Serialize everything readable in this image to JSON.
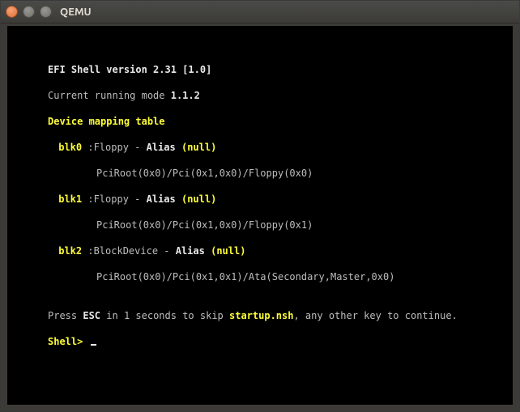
{
  "window": {
    "title": "QEMU"
  },
  "efi": {
    "shell_label": "EFI Shell version ",
    "shell_version": "2.31 [1.0]",
    "mode_label": "Current running mode ",
    "mode_value": "1.1.2",
    "table_header": "Device mapping table",
    "devices": [
      {
        "id_prefix": " blk0 ",
        "type_prefix": ":Floppy - ",
        "alias_label": "Alias ",
        "alias_value": "(null)",
        "path": "PciRoot(0x0)/Pci(0x1,0x0)/Floppy(0x0)"
      },
      {
        "id_prefix": " blk1 ",
        "type_prefix": ":Floppy - ",
        "alias_label": "Alias ",
        "alias_value": "(null)",
        "path": "PciRoot(0x0)/Pci(0x1,0x0)/Floppy(0x1)"
      },
      {
        "id_prefix": " blk2 ",
        "type_prefix": ":BlockDevice - ",
        "alias_label": "Alias ",
        "alias_value": "(null)",
        "path": "PciRoot(0x0)/Pci(0x1,0x1)/Ata(Secondary,Master,0x0)"
      }
    ],
    "press": "Press ",
    "esc": "ESC",
    "skip_mid": " in 1 seconds to skip ",
    "startup": "startup.nsh",
    "skip_end": ", any other key to continue.",
    "prompt": "Shell> "
  }
}
